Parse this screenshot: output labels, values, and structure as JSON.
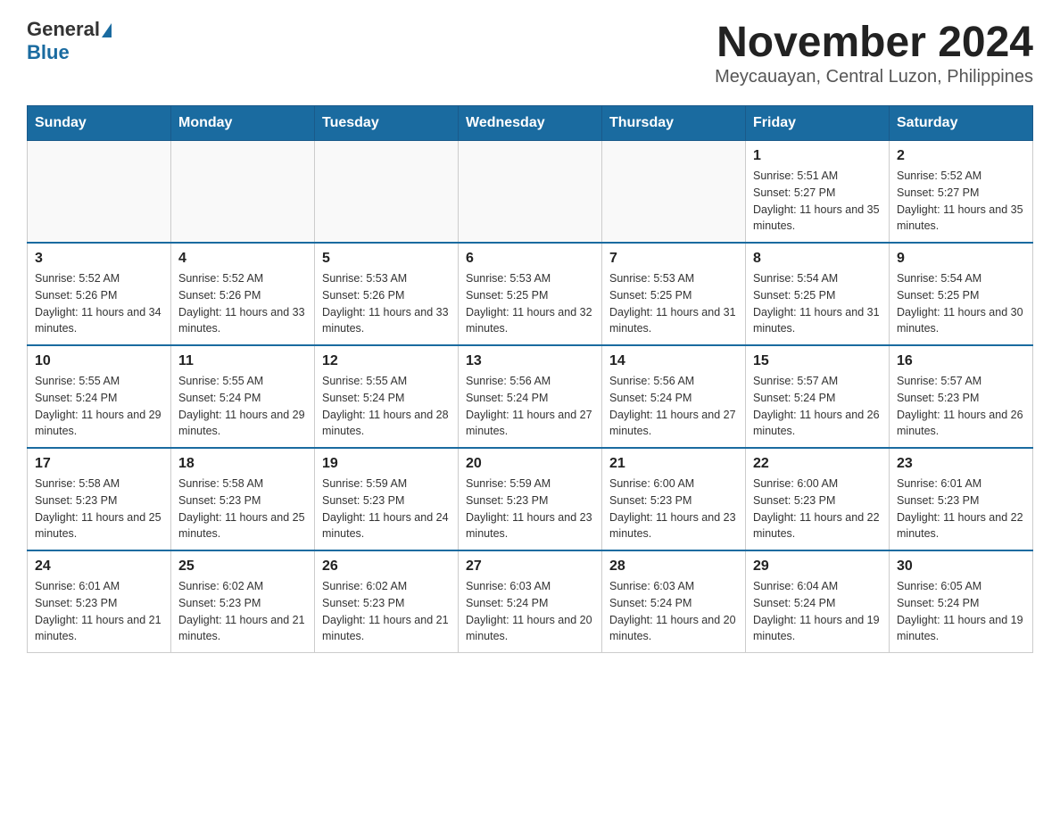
{
  "logo": {
    "text_general": "General",
    "text_blue": "Blue"
  },
  "title": "November 2024",
  "location": "Meycauayan, Central Luzon, Philippines",
  "days_of_week": [
    "Sunday",
    "Monday",
    "Tuesday",
    "Wednesday",
    "Thursday",
    "Friday",
    "Saturday"
  ],
  "weeks": [
    [
      {
        "day": "",
        "info": ""
      },
      {
        "day": "",
        "info": ""
      },
      {
        "day": "",
        "info": ""
      },
      {
        "day": "",
        "info": ""
      },
      {
        "day": "",
        "info": ""
      },
      {
        "day": "1",
        "info": "Sunrise: 5:51 AM\nSunset: 5:27 PM\nDaylight: 11 hours and 35 minutes."
      },
      {
        "day": "2",
        "info": "Sunrise: 5:52 AM\nSunset: 5:27 PM\nDaylight: 11 hours and 35 minutes."
      }
    ],
    [
      {
        "day": "3",
        "info": "Sunrise: 5:52 AM\nSunset: 5:26 PM\nDaylight: 11 hours and 34 minutes."
      },
      {
        "day": "4",
        "info": "Sunrise: 5:52 AM\nSunset: 5:26 PM\nDaylight: 11 hours and 33 minutes."
      },
      {
        "day": "5",
        "info": "Sunrise: 5:53 AM\nSunset: 5:26 PM\nDaylight: 11 hours and 33 minutes."
      },
      {
        "day": "6",
        "info": "Sunrise: 5:53 AM\nSunset: 5:25 PM\nDaylight: 11 hours and 32 minutes."
      },
      {
        "day": "7",
        "info": "Sunrise: 5:53 AM\nSunset: 5:25 PM\nDaylight: 11 hours and 31 minutes."
      },
      {
        "day": "8",
        "info": "Sunrise: 5:54 AM\nSunset: 5:25 PM\nDaylight: 11 hours and 31 minutes."
      },
      {
        "day": "9",
        "info": "Sunrise: 5:54 AM\nSunset: 5:25 PM\nDaylight: 11 hours and 30 minutes."
      }
    ],
    [
      {
        "day": "10",
        "info": "Sunrise: 5:55 AM\nSunset: 5:24 PM\nDaylight: 11 hours and 29 minutes."
      },
      {
        "day": "11",
        "info": "Sunrise: 5:55 AM\nSunset: 5:24 PM\nDaylight: 11 hours and 29 minutes."
      },
      {
        "day": "12",
        "info": "Sunrise: 5:55 AM\nSunset: 5:24 PM\nDaylight: 11 hours and 28 minutes."
      },
      {
        "day": "13",
        "info": "Sunrise: 5:56 AM\nSunset: 5:24 PM\nDaylight: 11 hours and 27 minutes."
      },
      {
        "day": "14",
        "info": "Sunrise: 5:56 AM\nSunset: 5:24 PM\nDaylight: 11 hours and 27 minutes."
      },
      {
        "day": "15",
        "info": "Sunrise: 5:57 AM\nSunset: 5:24 PM\nDaylight: 11 hours and 26 minutes."
      },
      {
        "day": "16",
        "info": "Sunrise: 5:57 AM\nSunset: 5:23 PM\nDaylight: 11 hours and 26 minutes."
      }
    ],
    [
      {
        "day": "17",
        "info": "Sunrise: 5:58 AM\nSunset: 5:23 PM\nDaylight: 11 hours and 25 minutes."
      },
      {
        "day": "18",
        "info": "Sunrise: 5:58 AM\nSunset: 5:23 PM\nDaylight: 11 hours and 25 minutes."
      },
      {
        "day": "19",
        "info": "Sunrise: 5:59 AM\nSunset: 5:23 PM\nDaylight: 11 hours and 24 minutes."
      },
      {
        "day": "20",
        "info": "Sunrise: 5:59 AM\nSunset: 5:23 PM\nDaylight: 11 hours and 23 minutes."
      },
      {
        "day": "21",
        "info": "Sunrise: 6:00 AM\nSunset: 5:23 PM\nDaylight: 11 hours and 23 minutes."
      },
      {
        "day": "22",
        "info": "Sunrise: 6:00 AM\nSunset: 5:23 PM\nDaylight: 11 hours and 22 minutes."
      },
      {
        "day": "23",
        "info": "Sunrise: 6:01 AM\nSunset: 5:23 PM\nDaylight: 11 hours and 22 minutes."
      }
    ],
    [
      {
        "day": "24",
        "info": "Sunrise: 6:01 AM\nSunset: 5:23 PM\nDaylight: 11 hours and 21 minutes."
      },
      {
        "day": "25",
        "info": "Sunrise: 6:02 AM\nSunset: 5:23 PM\nDaylight: 11 hours and 21 minutes."
      },
      {
        "day": "26",
        "info": "Sunrise: 6:02 AM\nSunset: 5:23 PM\nDaylight: 11 hours and 21 minutes."
      },
      {
        "day": "27",
        "info": "Sunrise: 6:03 AM\nSunset: 5:24 PM\nDaylight: 11 hours and 20 minutes."
      },
      {
        "day": "28",
        "info": "Sunrise: 6:03 AM\nSunset: 5:24 PM\nDaylight: 11 hours and 20 minutes."
      },
      {
        "day": "29",
        "info": "Sunrise: 6:04 AM\nSunset: 5:24 PM\nDaylight: 11 hours and 19 minutes."
      },
      {
        "day": "30",
        "info": "Sunrise: 6:05 AM\nSunset: 5:24 PM\nDaylight: 11 hours and 19 minutes."
      }
    ]
  ]
}
